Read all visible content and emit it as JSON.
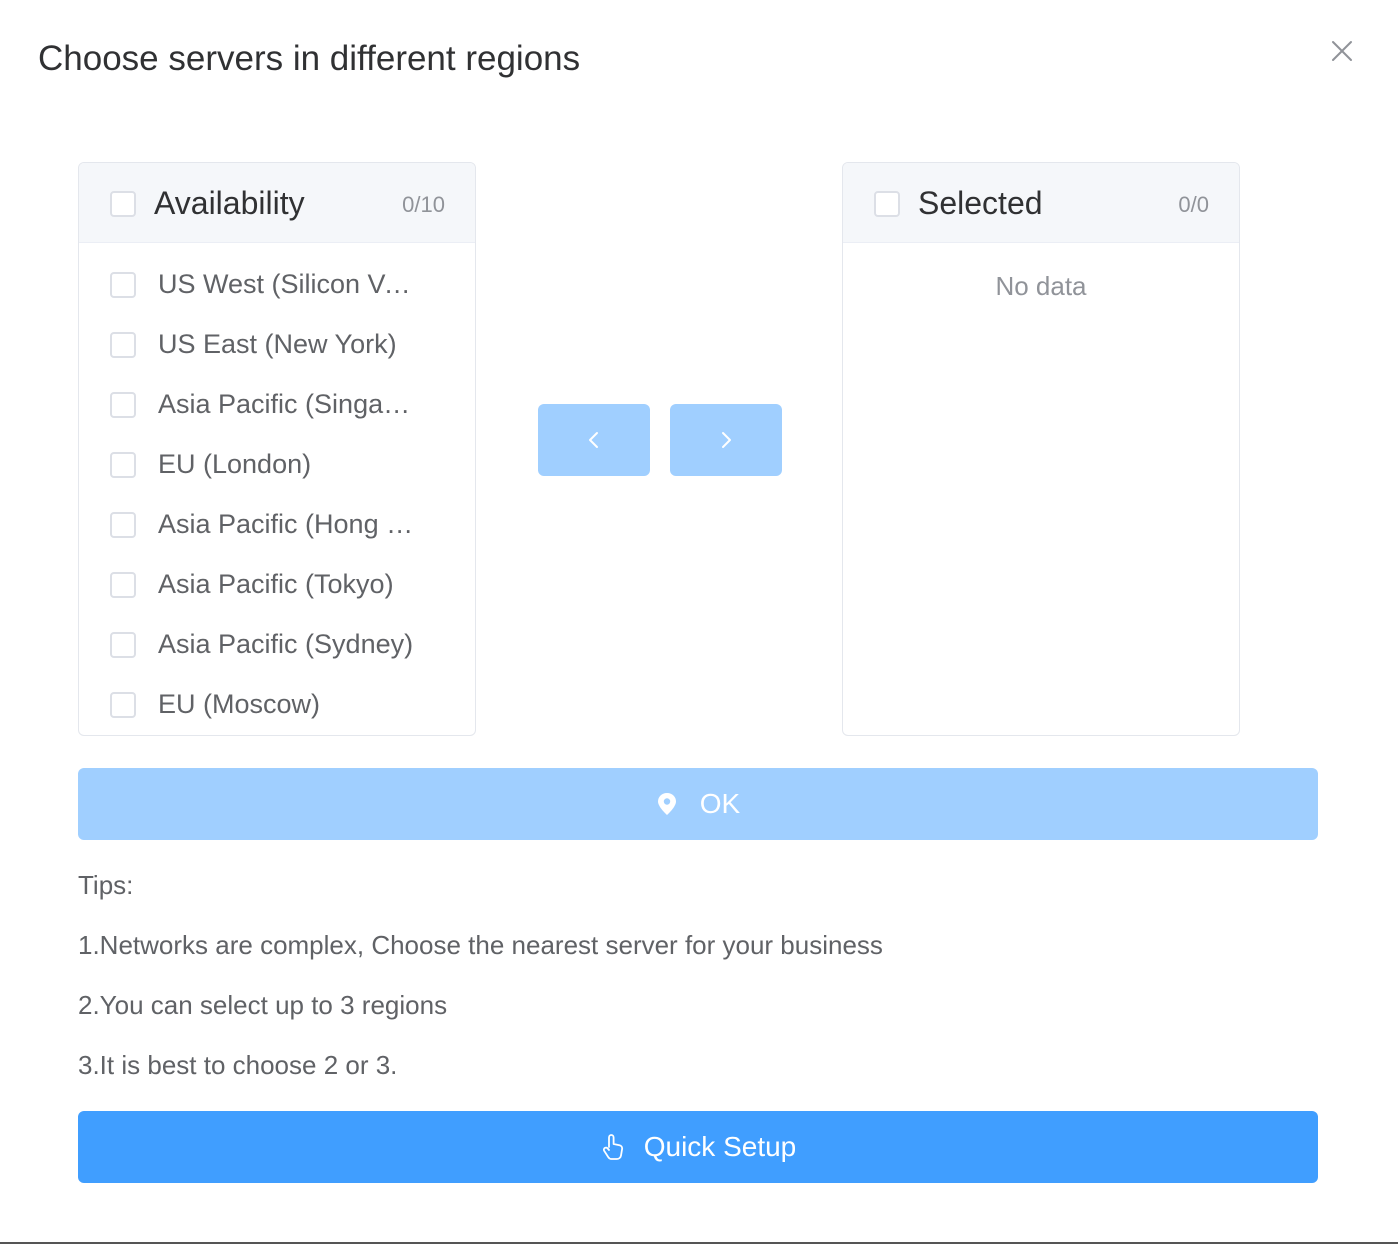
{
  "dialog": {
    "title": "Choose servers in different regions",
    "close_icon": "close-icon"
  },
  "source_panel": {
    "title": "Availability",
    "count": "0/10",
    "items": [
      {
        "label": "US West (Silicon Valley)",
        "checked": false
      },
      {
        "label": "US East (New York)",
        "checked": false
      },
      {
        "label": "Asia Pacific (Singapore)",
        "checked": false
      },
      {
        "label": "EU (London)",
        "checked": false
      },
      {
        "label": "Asia Pacific (Hong Kong)",
        "checked": false
      },
      {
        "label": "Asia Pacific (Tokyo)",
        "checked": false
      },
      {
        "label": "Asia Pacific (Sydney)",
        "checked": false
      },
      {
        "label": "EU (Moscow)",
        "checked": false
      }
    ]
  },
  "target_panel": {
    "title": "Selected",
    "count": "0/0",
    "empty_text": "No data"
  },
  "transfer_buttons": {
    "to_left_icon": "chevron-left-icon",
    "to_right_icon": "chevron-right-icon"
  },
  "ok_button": {
    "label": "OK",
    "icon": "location-pin-icon"
  },
  "tips": {
    "heading": "Tips:",
    "lines": [
      "1.Networks are complex, Choose the nearest server for your business",
      "2.You can select up to 3 regions",
      "3.It is best to choose 2 or 3."
    ]
  },
  "quick_setup_button": {
    "label": "Quick Setup",
    "icon": "pointing-hand-icon"
  },
  "colors": {
    "primary": "#409eff",
    "primary_disabled": "#a0cfff",
    "border": "#e4e7ed",
    "header_bg": "#f5f7fa",
    "text_primary": "#303133",
    "text_regular": "#606266",
    "text_secondary": "#909399"
  }
}
